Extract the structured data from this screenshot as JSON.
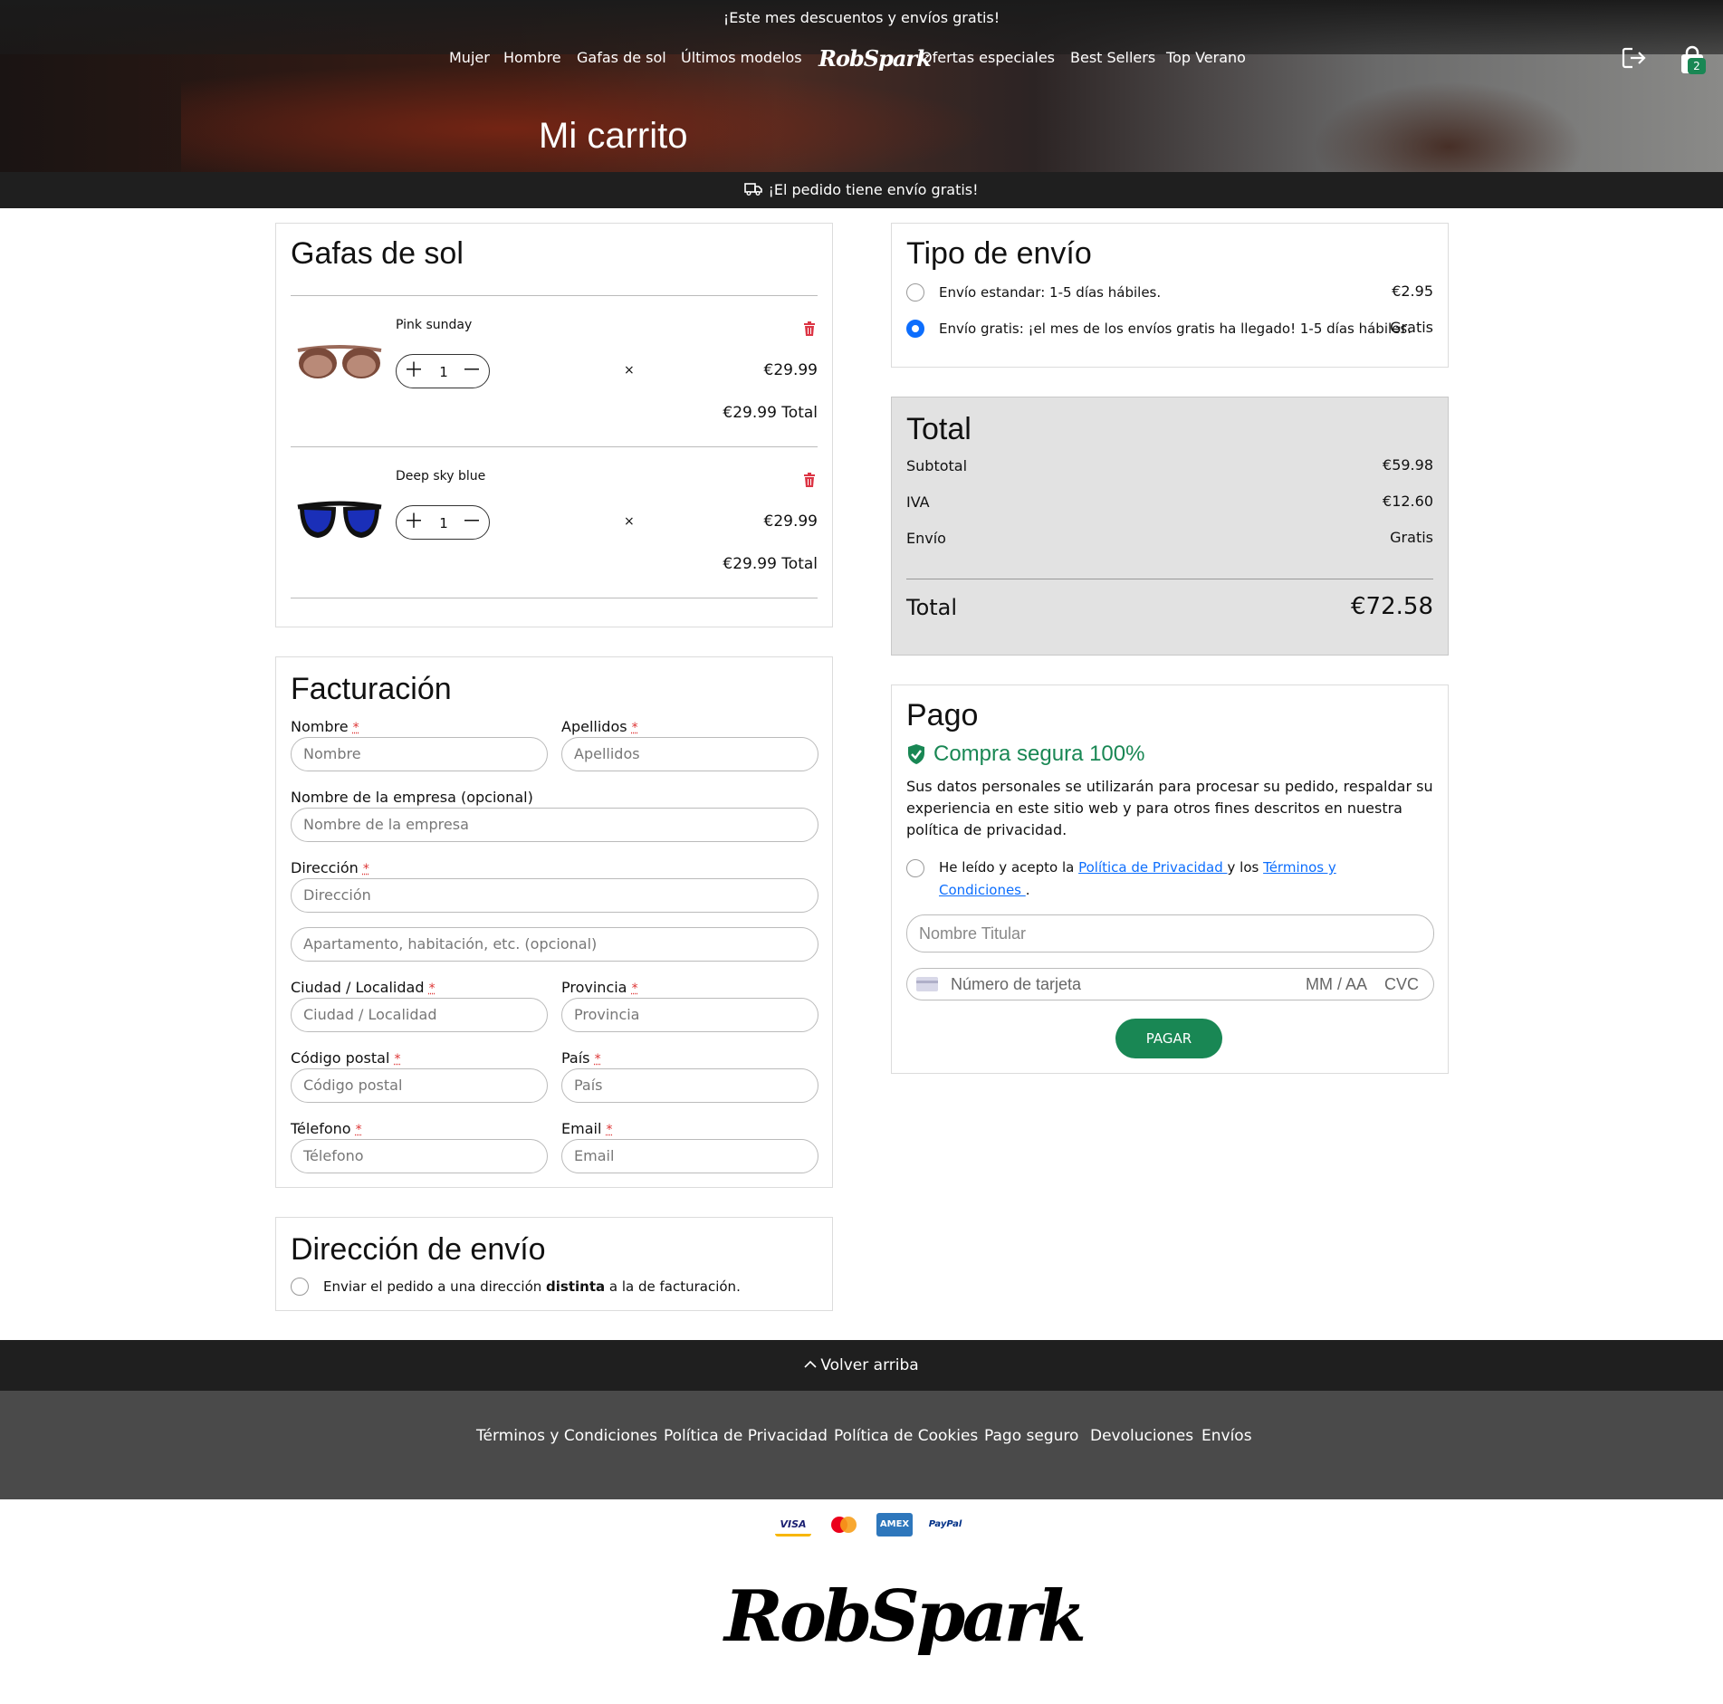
{
  "header": {
    "promo": "¡Este mes descuentos y envíos gratis!",
    "nav_left": [
      "Mujer",
      "Hombre",
      "Gafas de sol",
      "Últimos modelos"
    ],
    "logo": "RobSpark",
    "nav_right": [
      "Ofertas especiales",
      "Best Sellers",
      "Top Verano"
    ],
    "cart_count": "2",
    "page_title": "Mi carrito",
    "shipping_notice": "¡El pedido tiene envío gratis!"
  },
  "cart": {
    "title": "Gafas de sol",
    "items": [
      {
        "name": "Pink sunday",
        "qty": "1",
        "times": "×",
        "unit_price": "€29.99",
        "total": "€29.99 Total"
      },
      {
        "name": "Deep sky blue",
        "qty": "1",
        "times": "×",
        "unit_price": "€29.99",
        "total": "€29.99 Total"
      }
    ]
  },
  "billing": {
    "title": "Facturación",
    "req_mark": "*",
    "fields": {
      "nombre_label": "Nombre",
      "nombre_ph": "Nombre",
      "apellidos_label": "Apellidos",
      "apellidos_ph": "Apellidos",
      "empresa_label": "Nombre de la empresa (opcional)",
      "empresa_ph": "Nombre de la empresa",
      "direccion_label": "Dirección",
      "direccion_ph": "Dirección",
      "apartamento_ph": "Apartamento, habitación, etc. (opcional)",
      "ciudad_label": "Ciudad / Localidad",
      "ciudad_ph": "Ciudad / Localidad",
      "provincia_label": "Provincia",
      "provincia_ph": "Provincia",
      "cp_label": "Código postal",
      "cp_ph": "Código postal",
      "pais_label": "País",
      "pais_ph": "País",
      "telefono_label": "Télefono",
      "telefono_ph": "Télefono",
      "email_label": "Email",
      "email_ph": "Email"
    }
  },
  "shipping_address": {
    "title": "Dirección de envío",
    "checkbox_pre": "Enviar el pedido a una dirección ",
    "checkbox_bold": "distinta",
    "checkbox_post": " a la de facturación."
  },
  "shipping_type": {
    "title": "Tipo de envío",
    "options": [
      {
        "label": "Envío estandar: 1-5 días hábiles.",
        "price": "€2.95",
        "selected": false
      },
      {
        "label": "Envío gratis: ¡el mes de los envíos gratis ha llegado! 1-5 días hábiles.",
        "price": "Gratis",
        "selected": true
      }
    ]
  },
  "totals": {
    "title": "Total",
    "subtotal_label": "Subtotal",
    "subtotal": "€59.98",
    "iva_label": "IVA",
    "iva": "€12.60",
    "envio_label": "Envío",
    "envio": "Gratis",
    "total_label": "Total",
    "total": "€72.58"
  },
  "payment": {
    "title": "Pago",
    "secure": "Compra segura 100%",
    "privacy_line1": "Sus datos personales se utilizarán para procesar su pedido, respaldar su",
    "privacy_line2": "experiencia en este sitio web y para otros fines descritos en nuestra",
    "privacy_line3": "política de privacidad.",
    "accept_pre": "He leído y acepto la ",
    "privacy_link": "Política de Privacidad ",
    "accept_mid": "y los ",
    "terms_link_1": "Términos y",
    "terms_link_2": "Condiciones ",
    "accept_post": ".",
    "holder_ph": "Nombre Titular",
    "card_ph": "Número de tarjeta",
    "exp_ph": "MM / AA",
    "cvc_ph": "CVC",
    "pay_button": "PAGAR"
  },
  "footer": {
    "back_to_top": "Volver arriba",
    "links": [
      "Términos y Condiciones",
      "Política de Privacidad",
      "Política de Cookies",
      "Pago seguro",
      "Devoluciones",
      "Envíos"
    ],
    "payment_icons": [
      "VISA",
      "MasterCard",
      "AMEX",
      "PayPal"
    ],
    "logo": "RobSpark"
  },
  "colors": {
    "accent_green": "#198754",
    "link_blue": "#0d6efd",
    "dark_bar": "#1f1f1f",
    "footer_gray": "#4a4a4a",
    "total_bg": "#e2e2e2",
    "trash_red": "#dc3545"
  }
}
